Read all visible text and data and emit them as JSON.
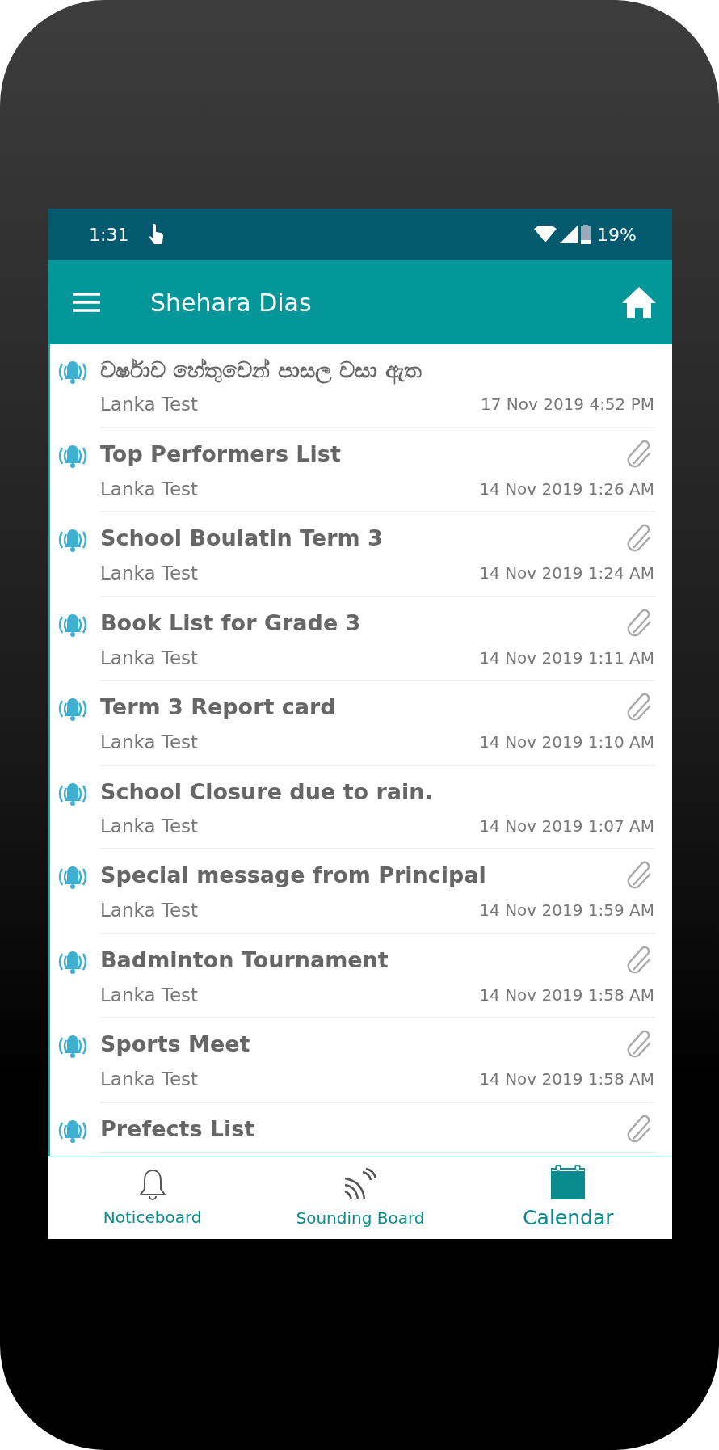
{
  "status_bar": {
    "time": "1:31",
    "battery": "19%"
  },
  "app_bar": {
    "title": "Shehara Dias"
  },
  "notices": [
    {
      "title": "වර්ෂාව හේතුවෙන් පාසල වසා ඇත",
      "sender": "Lanka Test",
      "date": "17 Nov 2019 4:52 PM",
      "attachment": false
    },
    {
      "title": "Top Performers List",
      "sender": "Lanka Test",
      "date": "14 Nov 2019 1:26 AM",
      "attachment": true
    },
    {
      "title": "School Boulatin Term 3",
      "sender": "Lanka Test",
      "date": "14 Nov 2019 1:24 AM",
      "attachment": true
    },
    {
      "title": "Book List for Grade 3",
      "sender": "Lanka Test",
      "date": "14 Nov 2019 1:11 AM",
      "attachment": true
    },
    {
      "title": "Term 3 Report card",
      "sender": "Lanka Test",
      "date": "14 Nov 2019 1:10 AM",
      "attachment": true
    },
    {
      "title": "School Closure due to rain.",
      "sender": "Lanka Test",
      "date": "14 Nov 2019 1:07 AM",
      "attachment": false
    },
    {
      "title": "Special message from Principal",
      "sender": "Lanka Test",
      "date": "14 Nov 2019 1:59 AM",
      "attachment": true
    },
    {
      "title": "Badminton Tournament",
      "sender": "Lanka Test",
      "date": "14 Nov 2019 1:58 AM",
      "attachment": true
    },
    {
      "title": "Sports Meet",
      "sender": "Lanka Test",
      "date": "14 Nov 2019 1:58 AM",
      "attachment": true
    },
    {
      "title": "Prefects List",
      "attachment": true
    }
  ],
  "bottom_nav": [
    {
      "label": "Noticeboard",
      "kind": "bell",
      "selected": false
    },
    {
      "label": "Sounding Board",
      "kind": "waves",
      "selected": false
    },
    {
      "label": "Calendar",
      "kind": "calendar",
      "selected": true
    }
  ]
}
